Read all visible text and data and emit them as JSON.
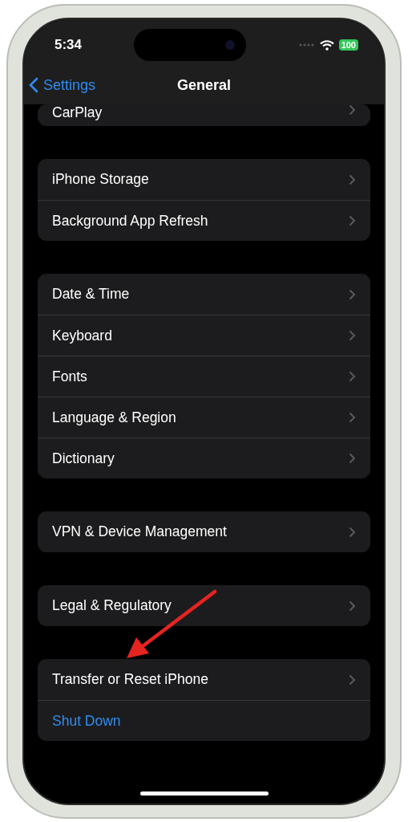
{
  "status_bar": {
    "time": "5:34",
    "battery": "100"
  },
  "nav_bar": {
    "back": "Settings",
    "title": "General"
  },
  "groups": [
    {
      "rows": [
        {
          "label": "CarPlay",
          "kind": "link"
        }
      ]
    },
    {
      "rows": [
        {
          "label": "iPhone Storage",
          "kind": "link"
        },
        {
          "label": "Background App Refresh",
          "kind": "link"
        }
      ]
    },
    {
      "rows": [
        {
          "label": "Date & Time",
          "kind": "link"
        },
        {
          "label": "Keyboard",
          "kind": "link"
        },
        {
          "label": "Fonts",
          "kind": "link"
        },
        {
          "label": "Language & Region",
          "kind": "link"
        },
        {
          "label": "Dictionary",
          "kind": "link"
        }
      ]
    },
    {
      "rows": [
        {
          "label": "VPN & Device Management",
          "kind": "link"
        }
      ]
    },
    {
      "rows": [
        {
          "label": "Legal & Regulatory",
          "kind": "link"
        }
      ]
    },
    {
      "rows": [
        {
          "label": "Transfer or Reset iPhone",
          "kind": "link"
        },
        {
          "label": "Shut Down",
          "kind": "action"
        }
      ]
    }
  ]
}
